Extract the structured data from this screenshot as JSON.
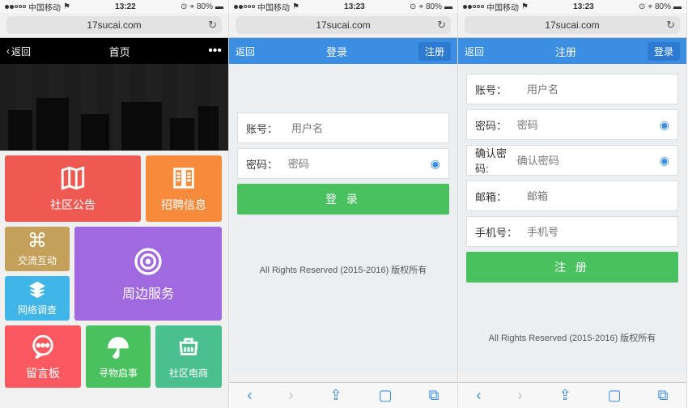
{
  "status": {
    "carrier": "中国移动",
    "time1": "13:22",
    "time2": "13:23",
    "time3": "13:23",
    "battery": "80%"
  },
  "url": "17sucai.com",
  "screen1": {
    "nav": {
      "back": "返回",
      "title": "首页",
      "right": "•••"
    },
    "tiles": {
      "announce": "社区公告",
      "recruit": "招聘信息",
      "interact": "交流互动",
      "survey": "网络调查",
      "nearby": "周边服务",
      "board": "留言板",
      "lost": "寻物启事",
      "shop": "社区电商"
    }
  },
  "screen2": {
    "nav": {
      "back": "返回",
      "title": "登录",
      "right": "注册"
    },
    "account_label": "账号：",
    "account_ph": "用户名",
    "password_label": "密码：",
    "password_ph": "密码",
    "submit": "登 录",
    "footer": "All Rights Reserved (2015-2016) 版权所有"
  },
  "screen3": {
    "nav": {
      "back": "返回",
      "title": "注册",
      "right": "登录"
    },
    "account_label": "账号：",
    "account_ph": "用户名",
    "password_label": "密码：",
    "password_ph": "密码",
    "confirm_label": "确认密码:",
    "confirm_ph": "确认密码",
    "email_label": "邮箱：",
    "email_ph": "邮箱",
    "phone_label": "手机号：",
    "phone_ph": "手机号",
    "submit": "注 册",
    "footer": "All Rights Reserved (2015-2016) 版权所有"
  }
}
